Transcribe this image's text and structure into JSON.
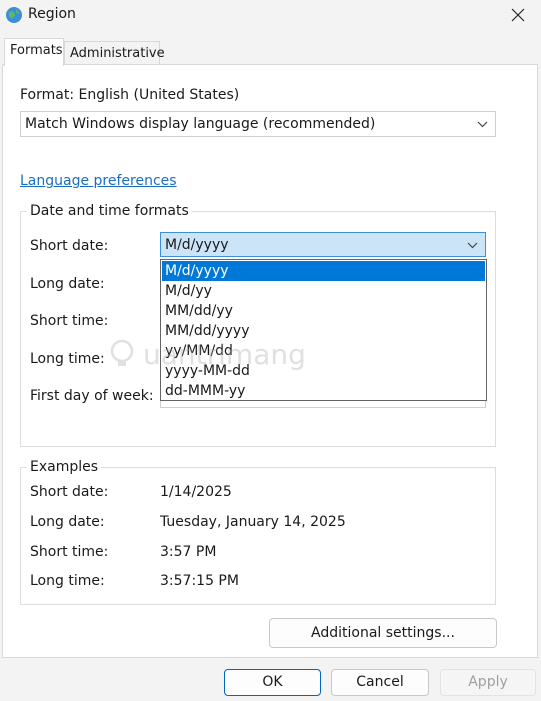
{
  "window": {
    "title": "Region"
  },
  "tabs": [
    {
      "label": "Formats",
      "active": true
    },
    {
      "label": "Administrative",
      "active": false
    }
  ],
  "format": {
    "label": "Format: English (United States)",
    "value": "Match Windows display language (recommended)"
  },
  "language_link": "Language preferences",
  "datetime": {
    "group_title": "Date and time formats",
    "short_date_label": "Short date:",
    "short_date_value": "M/d/yyyy",
    "long_date_label": "Long date:",
    "short_time_label": "Short time:",
    "long_time_label": "Long time:",
    "first_day_label": "First day of week:",
    "dropdown_options": [
      "M/d/yyyy",
      "M/d/yy",
      "MM/dd/yy",
      "MM/dd/yyyy",
      "yy/MM/dd",
      "yyyy-MM-dd",
      "dd-MMM-yy"
    ],
    "selected_option": "M/d/yyyy"
  },
  "examples": {
    "group_title": "Examples",
    "short_date_label": "Short date:",
    "short_date_value": "1/14/2025",
    "long_date_label": "Long date:",
    "long_date_value": "Tuesday, January 14, 2025",
    "short_time_label": "Short time:",
    "short_time_value": "3:57 PM",
    "long_time_label": "Long time:",
    "long_time_value": "3:57:15 PM"
  },
  "buttons": {
    "additional": "Additional settings...",
    "ok": "OK",
    "cancel": "Cancel",
    "apply": "Apply"
  },
  "watermark": "uantrimang",
  "colors": {
    "accent": "#0078d7",
    "link": "#1a6ebf",
    "selection_bg": "#cce4f7"
  }
}
